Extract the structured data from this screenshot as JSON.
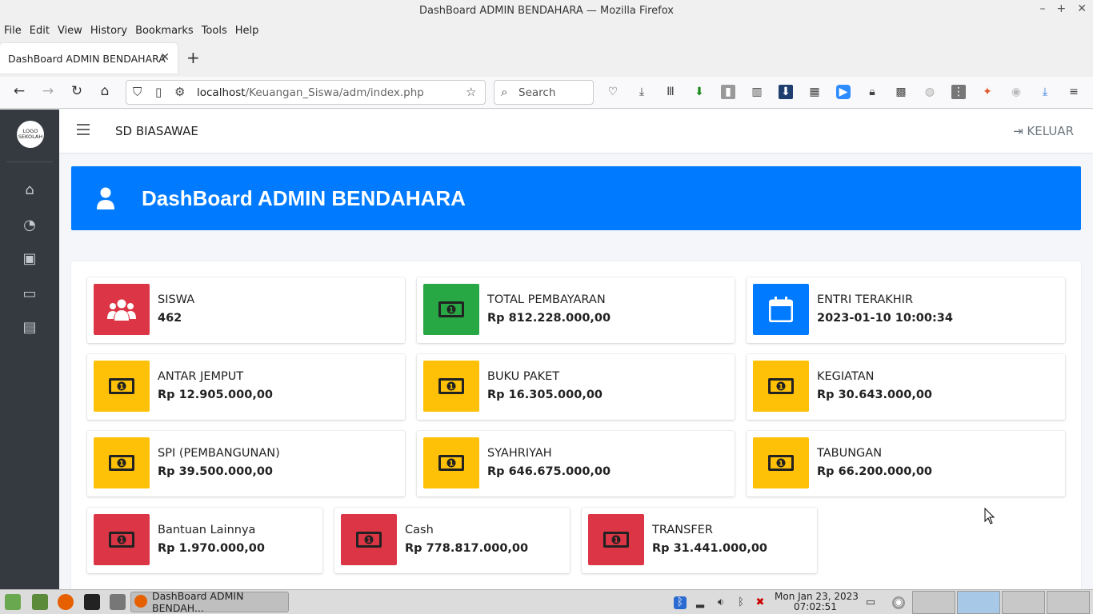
{
  "browser": {
    "window_title": "DashBoard ADMIN BENDAHARA — Mozilla Firefox",
    "menu": [
      "File",
      "Edit",
      "View",
      "History",
      "Bookmarks",
      "Tools",
      "Help"
    ],
    "tab_title": "DashBoard ADMIN BENDAHARA",
    "url_host": "localhost",
    "url_path": "/Keuangan_Siswa/adm/index.php",
    "search_placeholder": "Search"
  },
  "app": {
    "logo_text": "LOGO SEKOLAH",
    "school_name": "SD BIASAWAE",
    "logout_label": "KELUAR",
    "banner_title": "DashBoard ADMIN BENDAHARA",
    "sidebar_icons": [
      "home-icon",
      "dashboard-icon",
      "briefcase-icon",
      "money-icon",
      "newspaper-icon"
    ]
  },
  "stats": [
    {
      "label": "SISWA",
      "value": "462",
      "color": "#dc3545",
      "icon": "users-icon"
    },
    {
      "label": "TOTAL PEMBAYARAN",
      "value": "Rp 812.228.000,00",
      "color": "#28a745",
      "icon": "money-icon"
    },
    {
      "label": "ENTRI TERAKHIR",
      "value": "2023-01-10 10:00:34",
      "color": "#007bff",
      "icon": "calendar-icon"
    },
    {
      "label": "ANTAR JEMPUT",
      "value": "Rp 12.905.000,00",
      "color": "#ffc107",
      "icon": "money-icon"
    },
    {
      "label": "BUKU PAKET",
      "value": "Rp 16.305.000,00",
      "color": "#ffc107",
      "icon": "money-icon"
    },
    {
      "label": "KEGIATAN",
      "value": "Rp 30.643.000,00",
      "color": "#ffc107",
      "icon": "money-icon"
    },
    {
      "label": "SPI (PEMBANGUNAN)",
      "value": "Rp 39.500.000,00",
      "color": "#ffc107",
      "icon": "money-icon"
    },
    {
      "label": "SYAHRIYAH",
      "value": "Rp 646.675.000,00",
      "color": "#ffc107",
      "icon": "money-icon"
    },
    {
      "label": "TABUNGAN",
      "value": "Rp 66.200.000,00",
      "color": "#ffc107",
      "icon": "money-icon"
    },
    {
      "label": "Bantuan Lainnya",
      "value": "Rp 1.970.000,00",
      "color": "#dc3545",
      "icon": "money-icon"
    },
    {
      "label": "Cash",
      "value": "Rp 778.817.000,00",
      "color": "#dc3545",
      "icon": "money-icon"
    },
    {
      "label": "TRANSFER",
      "value": "Rp 31.441.000,00",
      "color": "#dc3545",
      "icon": "money-icon"
    }
  ],
  "taskbar": {
    "task_label": "DashBoard ADMIN BENDAH...",
    "date": "Mon Jan 23, 2023",
    "time": "07:02:51"
  }
}
